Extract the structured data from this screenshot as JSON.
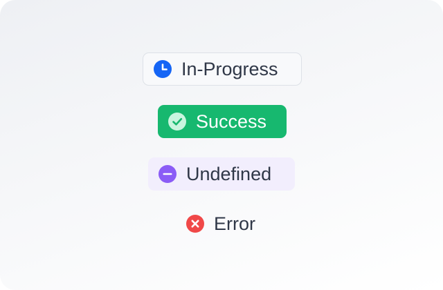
{
  "statuses": [
    {
      "label": "In-Progress",
      "icon": "clock-icon",
      "color": "#1565f5"
    },
    {
      "label": "Success",
      "icon": "check-circle-icon",
      "color": "#17b86f"
    },
    {
      "label": "Undefined",
      "icon": "minus-circle-icon",
      "color": "#8b5cf6"
    },
    {
      "label": "Error",
      "icon": "x-circle-icon",
      "color": "#f04848"
    }
  ]
}
